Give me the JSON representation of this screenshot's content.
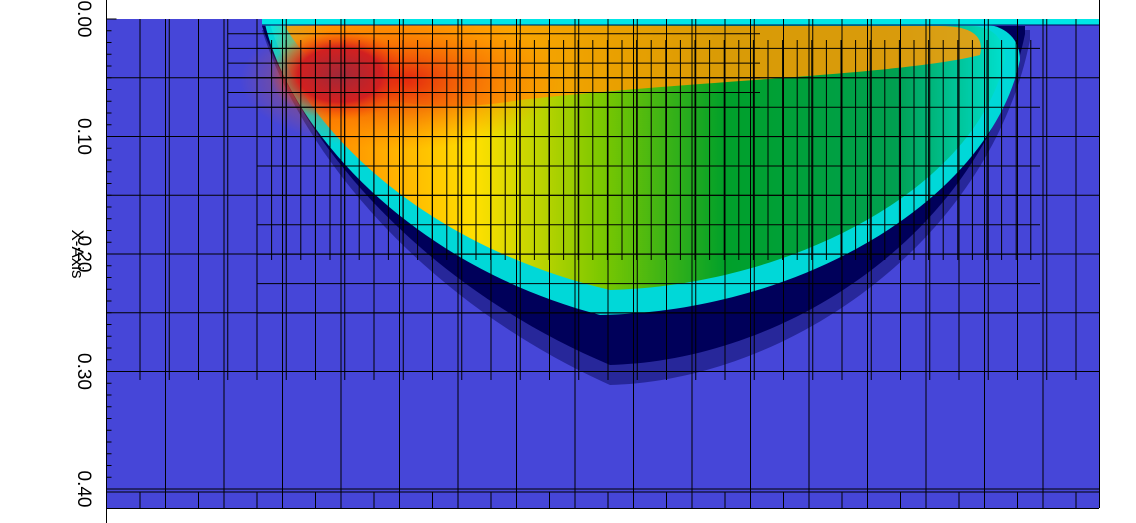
{
  "chart_data": {
    "type": "heatmap",
    "title": "",
    "axis_label": "X-Axis",
    "axis_range": [
      0.0,
      0.407
    ],
    "tick_labels": [
      "0.00",
      "0.10",
      "0.20",
      "0.30",
      "0.40"
    ],
    "tick_values": [
      0.0,
      0.1,
      0.2,
      0.3,
      0.4
    ],
    "grid": "adaptive mesh refinement blocks",
    "colormap": [
      "#4646d8",
      "#00005a",
      "#00e6e6",
      "#00a02a",
      "#fff000",
      "#ff8c00",
      "#d20000",
      "#b43c50"
    ],
    "background_color": "#4646d8",
    "legend": "none"
  }
}
